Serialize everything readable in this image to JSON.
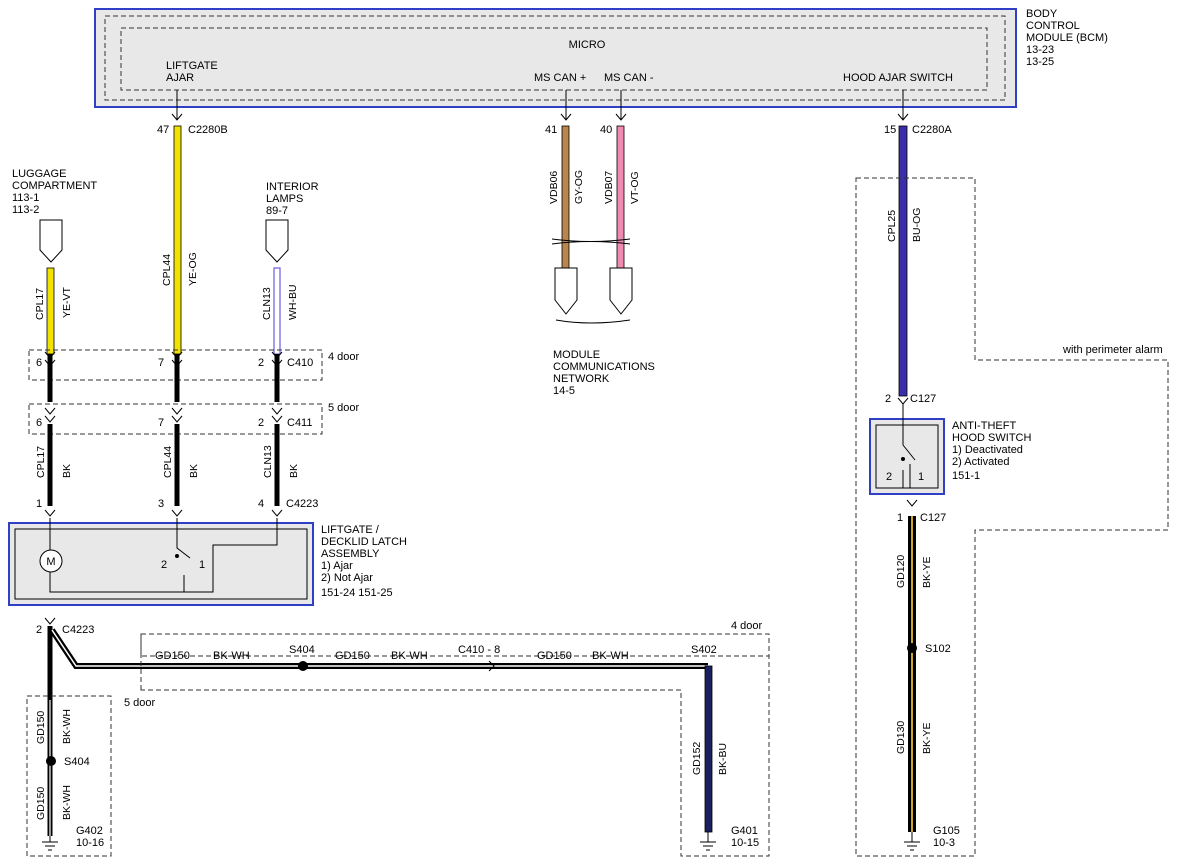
{
  "bcm": {
    "label_line1": "BODY",
    "label_line2": "CONTROL",
    "label_line3": "MODULE (BCM)",
    "ref1": "13-23",
    "ref2": "13-25",
    "micro": "MICRO",
    "liftgate_ajar_line1": "LIFTGATE",
    "liftgate_ajar_line2": "AJAR",
    "ms_can_plus": "MS CAN +",
    "ms_can_minus": "MS CAN -",
    "hood_ajar_switch": "HOOD AJAR SWITCH"
  },
  "connectors": {
    "c2280b": "C2280B",
    "c2280a": "C2280A",
    "c410": "C410",
    "c411": "C411",
    "c4223": "C4223",
    "c4223_lower": "C4223",
    "c127_top": "C127",
    "c127_bottom": "C127",
    "c410_8": "C410  -  8"
  },
  "pins": {
    "p47": "47",
    "p41": "41",
    "p40": "40",
    "p15": "15",
    "c410_6": "6",
    "c410_7": "7",
    "c410_2": "2",
    "c411_6": "6",
    "c411_7": "7",
    "c411_2": "2",
    "c4223_1": "1",
    "c4223_3": "3",
    "c4223_4": "4",
    "c4223_2": "2",
    "c127_2": "2",
    "c127_1": "1"
  },
  "circuits": {
    "cpl17_a": "CPL17",
    "ye_vt": "YE-VT",
    "cpl44_a": "CPL44",
    "ye_og": "YE-OG",
    "cln13_a": "CLN13",
    "wh_bu": "WH-BU",
    "cpl17_b": "CPL17",
    "bk_1": "BK",
    "cpl44_b": "CPL44",
    "bk_2": "BK",
    "cln13_b": "CLN13",
    "bk_3": "BK",
    "vdb06": "VDB06",
    "gy_og": "GY-OG",
    "vdb07": "VDB07",
    "vt_og": "VT-OG",
    "cpl25": "CPL25",
    "bu_og": "BU-OG",
    "gd150_h1": "GD150",
    "bk_wh_h1": "BK-WH",
    "gd150_h2": "GD150",
    "bk_wh_h2": "BK-WH",
    "gd150_h3": "GD150",
    "bk_wh_h3": "BK-WH",
    "gd150_v1": "GD150",
    "bk_wh_v1": "BK-WH",
    "gd150_v2": "GD150",
    "bk_wh_v2": "BK-WH",
    "gd152": "GD152",
    "bk_bu": "BK-BU",
    "gd120": "GD120",
    "bk_ye_1": "BK-YE",
    "gd130": "GD130",
    "bk_ye_2": "BK-YE"
  },
  "components": {
    "luggage_line1": "LUGGAGE",
    "luggage_line2": "COMPARTMENT",
    "luggage_ref1": "113-1",
    "luggage_ref2": "113-2",
    "interior_line1": "INTERIOR",
    "interior_line2": "LAMPS",
    "interior_ref": "89-7",
    "mcn_line1": "MODULE",
    "mcn_line2": "COMMUNICATIONS",
    "mcn_line3": "NETWORK",
    "mcn_ref": "14-5",
    "latch_line1": "LIFTGATE /",
    "latch_line2": "DECKLID LATCH",
    "latch_line3": "ASSEMBLY",
    "latch_state1": "1) Ajar",
    "latch_state2": "2) Not Ajar",
    "latch_ref": "151-24    151-25",
    "motor": "M",
    "latch_sw_2": "2",
    "latch_sw_1": "1",
    "hood_line1": "ANTI-THEFT",
    "hood_line2": "HOOD SWITCH",
    "hood_state1": "1) Deactivated",
    "hood_state2": "2) Activated",
    "hood_ref": "151-1",
    "hood_sw_2": "2",
    "hood_sw_1": "1"
  },
  "variants": {
    "four_door_a": "4 door",
    "five_door_a": "5 door",
    "four_door_b": "4 door",
    "five_door_b": "5 door",
    "perimeter": "with perimeter alarm"
  },
  "splices": {
    "s404_a": "S404",
    "s402": "S402",
    "s404_b": "S404",
    "s102": "S102"
  },
  "grounds": {
    "g402": "G402",
    "g402_ref": "10-16",
    "g401": "G401",
    "g401_ref": "10-15",
    "g105": "G105",
    "g105_ref": "10-3"
  },
  "colors": {
    "yellow": "#f2e200",
    "blue_violet": "#3a2fa8",
    "violet_thin": "#6a5ae0",
    "gray_orange": "#b8864e",
    "pink": "#f08ab0",
    "navy": "#1a1f5e",
    "gold_stripe": "#c9a52a",
    "box_fill": "#e8e8e8",
    "box_border": "#2f3fc8"
  }
}
